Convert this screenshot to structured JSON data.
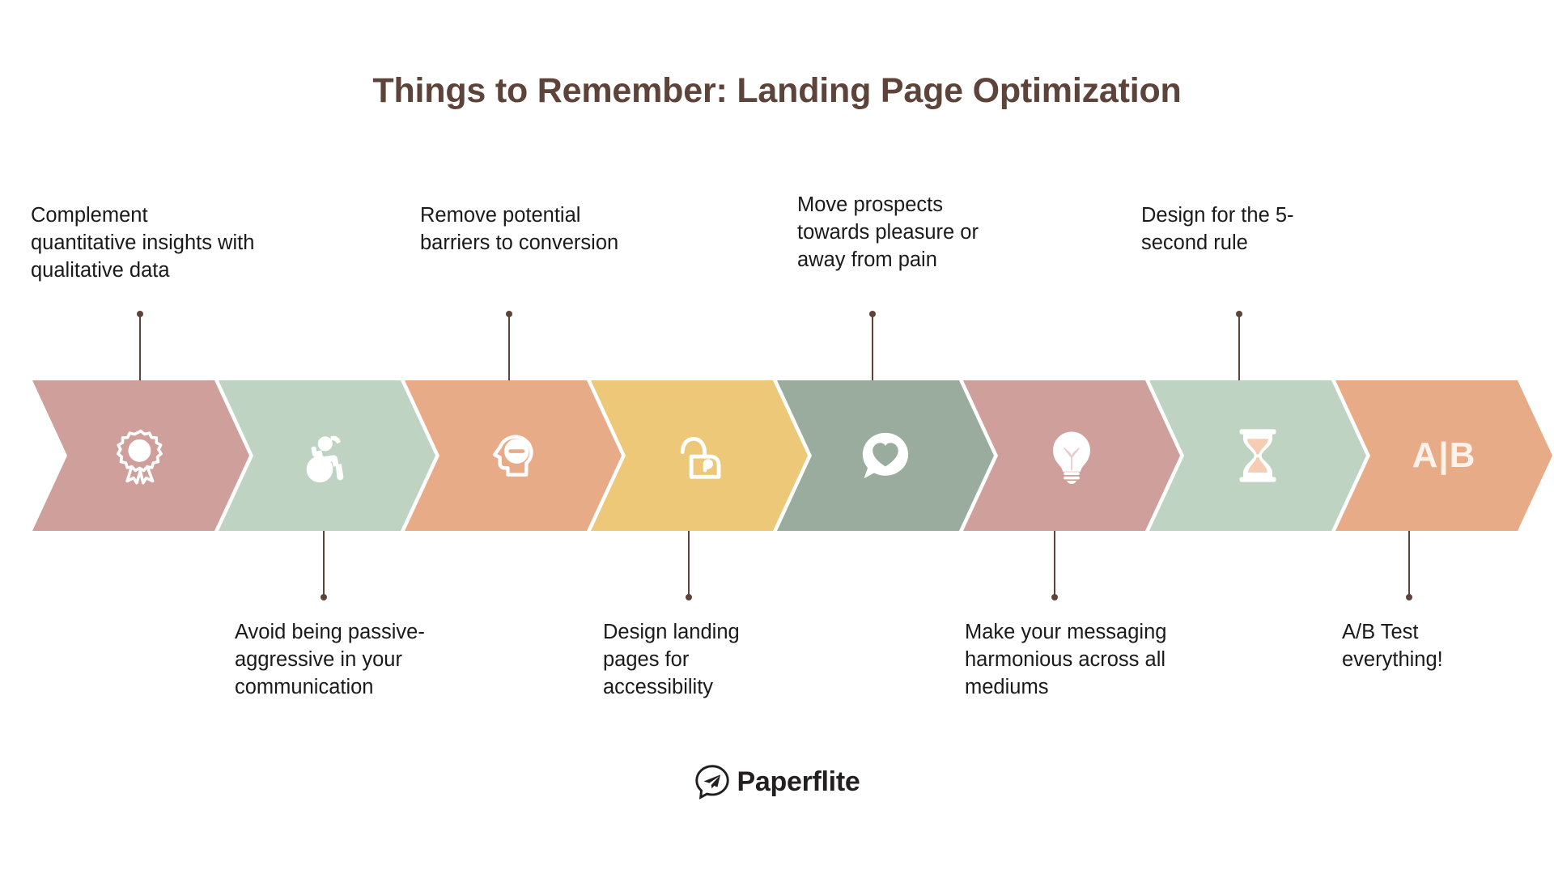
{
  "title": "Things to Remember: Landing Page Optimization",
  "colors": {
    "title_brown": "#5d4339",
    "connector_brown": "#5d4339",
    "label_text": "#1a1a1a",
    "icon_white": "#ffffff",
    "background": "#ffffff",
    "rose": "#cf9f9b",
    "sage_light": "#bfd3c3",
    "peach": "#e8ab88",
    "gold": "#ecc878",
    "sage_dark": "#9aac9d",
    "rose2": "#cf9f9b",
    "sage_light2": "#bfd3c3",
    "peach2": "#e8ab88"
  },
  "steps": [
    {
      "index": 1,
      "label": "Complement quantitative insights with qualitative data",
      "icon": "award-ribbon-icon",
      "color": "#cf9f9b",
      "label_position": "above"
    },
    {
      "index": 2,
      "label": "Avoid being passive-aggressive in your communication",
      "icon": "angry-person-icon",
      "color": "#bfd3c3",
      "label_position": "below"
    },
    {
      "index": 3,
      "label": "Remove potential barriers to conversion",
      "icon": "head-barrier-icon",
      "color": "#e8ab88",
      "label_position": "above"
    },
    {
      "index": 4,
      "label": "Design landing pages for accessibility",
      "icon": "open-padlock-icon",
      "color": "#ecc878",
      "label_position": "below"
    },
    {
      "index": 5,
      "label": "Move prospects towards pleasure or away from pain",
      "icon": "speech-bubble-heart-icon",
      "color": "#9aac9d",
      "label_position": "above"
    },
    {
      "index": 6,
      "label": "Make your messaging harmonious across all mediums",
      "icon": "lightbulb-icon",
      "color": "#cf9f9b",
      "label_position": "below"
    },
    {
      "index": 7,
      "label": "Design for the 5-second rule",
      "icon": "hourglass-icon",
      "color": "#bfd3c3",
      "label_position": "above"
    },
    {
      "index": 8,
      "label": "A/B Test everything!",
      "icon": "ab-test-icon",
      "icon_text": "A|B",
      "color": "#e8ab88",
      "label_position": "below"
    }
  ],
  "logo": {
    "name": "Paperflite",
    "mark": "paper-plane-speech-bubble-icon"
  }
}
